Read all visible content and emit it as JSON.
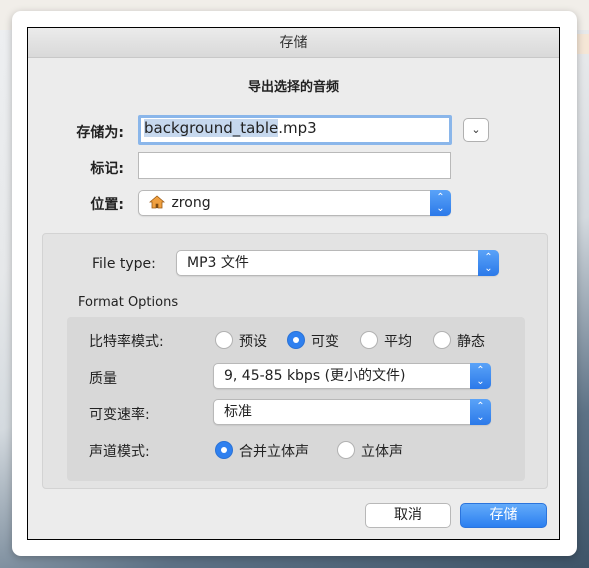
{
  "window": {
    "title": "存储"
  },
  "dialog": {
    "subtitle": "导出选择的音频",
    "save_as": {
      "label": "存储为:",
      "value_selected": "background_table",
      "value_ext": ".mp3"
    },
    "tags": {
      "label": "标记:",
      "value": ""
    },
    "location": {
      "label": "位置:",
      "value": "zrong",
      "icon": "home-folder-icon"
    },
    "file_type": {
      "label": "File type:",
      "value": "MP3 文件"
    },
    "format_options": {
      "title": "Format Options",
      "bitrate_mode": {
        "label": "比特率模式:",
        "options": [
          "预设",
          "可变",
          "平均",
          "静态"
        ],
        "selected": "可变"
      },
      "quality": {
        "label": "质量",
        "value": "9, 45-85 kbps (更小的文件)"
      },
      "variable_speed": {
        "label": "可变速率:",
        "value": "标准"
      },
      "channel_mode": {
        "label": "声道模式:",
        "options": [
          "合并立体声",
          "立体声"
        ],
        "selected": "合并立体声"
      }
    },
    "buttons": {
      "cancel": "取消",
      "save": "存储"
    }
  },
  "colors": {
    "accent": "#2f80ef",
    "focus_ring": "#8ab6ea",
    "selection": "#c6d8ee"
  }
}
